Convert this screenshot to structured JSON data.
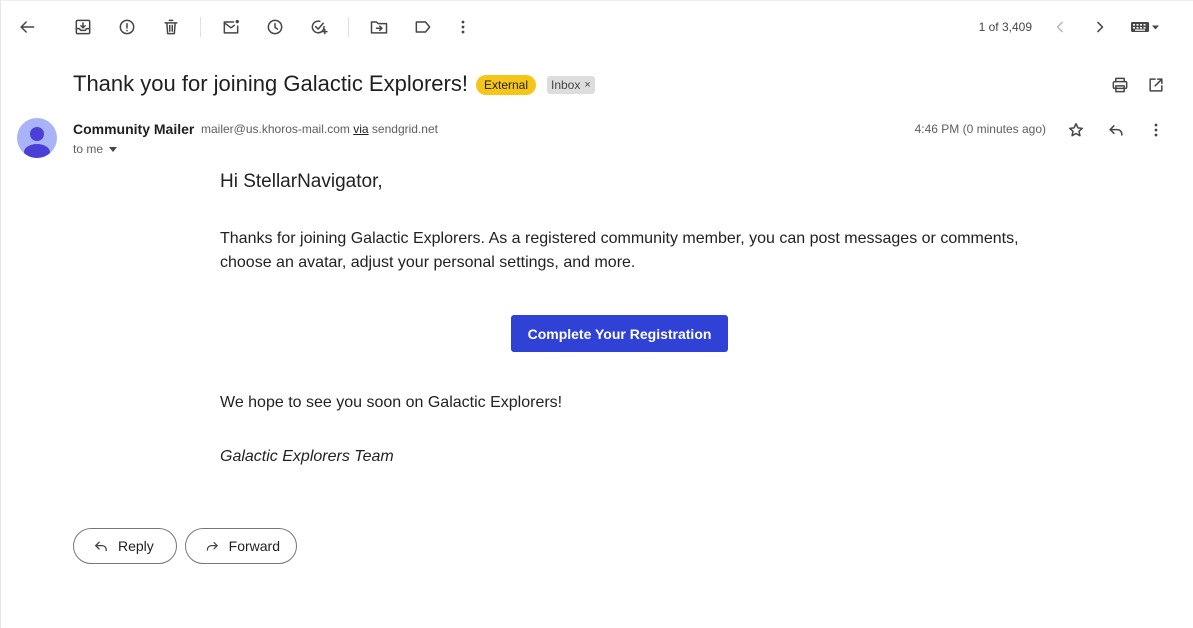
{
  "toolbar": {
    "back": "arrow-left-icon",
    "archive": "archive-icon",
    "report_spam": "report-icon",
    "delete": "trash-icon",
    "mark_unread": "mark-unread-icon",
    "snooze": "clock-icon",
    "add_task": "add-task-icon",
    "move_to": "move-folder-icon",
    "labels": "label-icon",
    "more": "more-vertical-icon"
  },
  "pager": {
    "text": "1 of 3,409",
    "prev": "chevron-left-icon",
    "next": "chevron-right-icon",
    "input_tools": "keyboard-icon"
  },
  "subject": {
    "title": "Thank you for joining Galactic Explorers!",
    "label_external": "External",
    "label_inbox": "Inbox",
    "label_inbox_remove": "×",
    "colors": {
      "external_bg": "#f5c518",
      "inbox_bg": "#dddddd"
    }
  },
  "header_actions": {
    "print": "print-icon",
    "open_new_window": "open-in-new-icon"
  },
  "message": {
    "sender_name": "Community Mailer",
    "sender_email": "mailer@us.khoros-mail.com",
    "via_label": "via",
    "via_domain": "sendgrid.net",
    "to": "to me",
    "timestamp": "4:46 PM (0 minutes ago)",
    "star": "star-icon",
    "reply": "reply-icon",
    "more": "more-vertical-icon"
  },
  "email_body": {
    "greeting": "Hi StellarNavigator,",
    "paragraph": "Thanks for joining Galactic Explorers. As a registered community member, you can post messages or comments, choose an avatar, adjust your personal settings, and more.",
    "cta_label": "Complete Your Registration",
    "closing": "We hope to see you soon on Galactic Explorers!",
    "signature": "Galactic Explorers Team",
    "colors": {
      "cta_bg": "#3041d6"
    }
  },
  "actions": {
    "reply_label": "Reply",
    "forward_label": "Forward"
  }
}
